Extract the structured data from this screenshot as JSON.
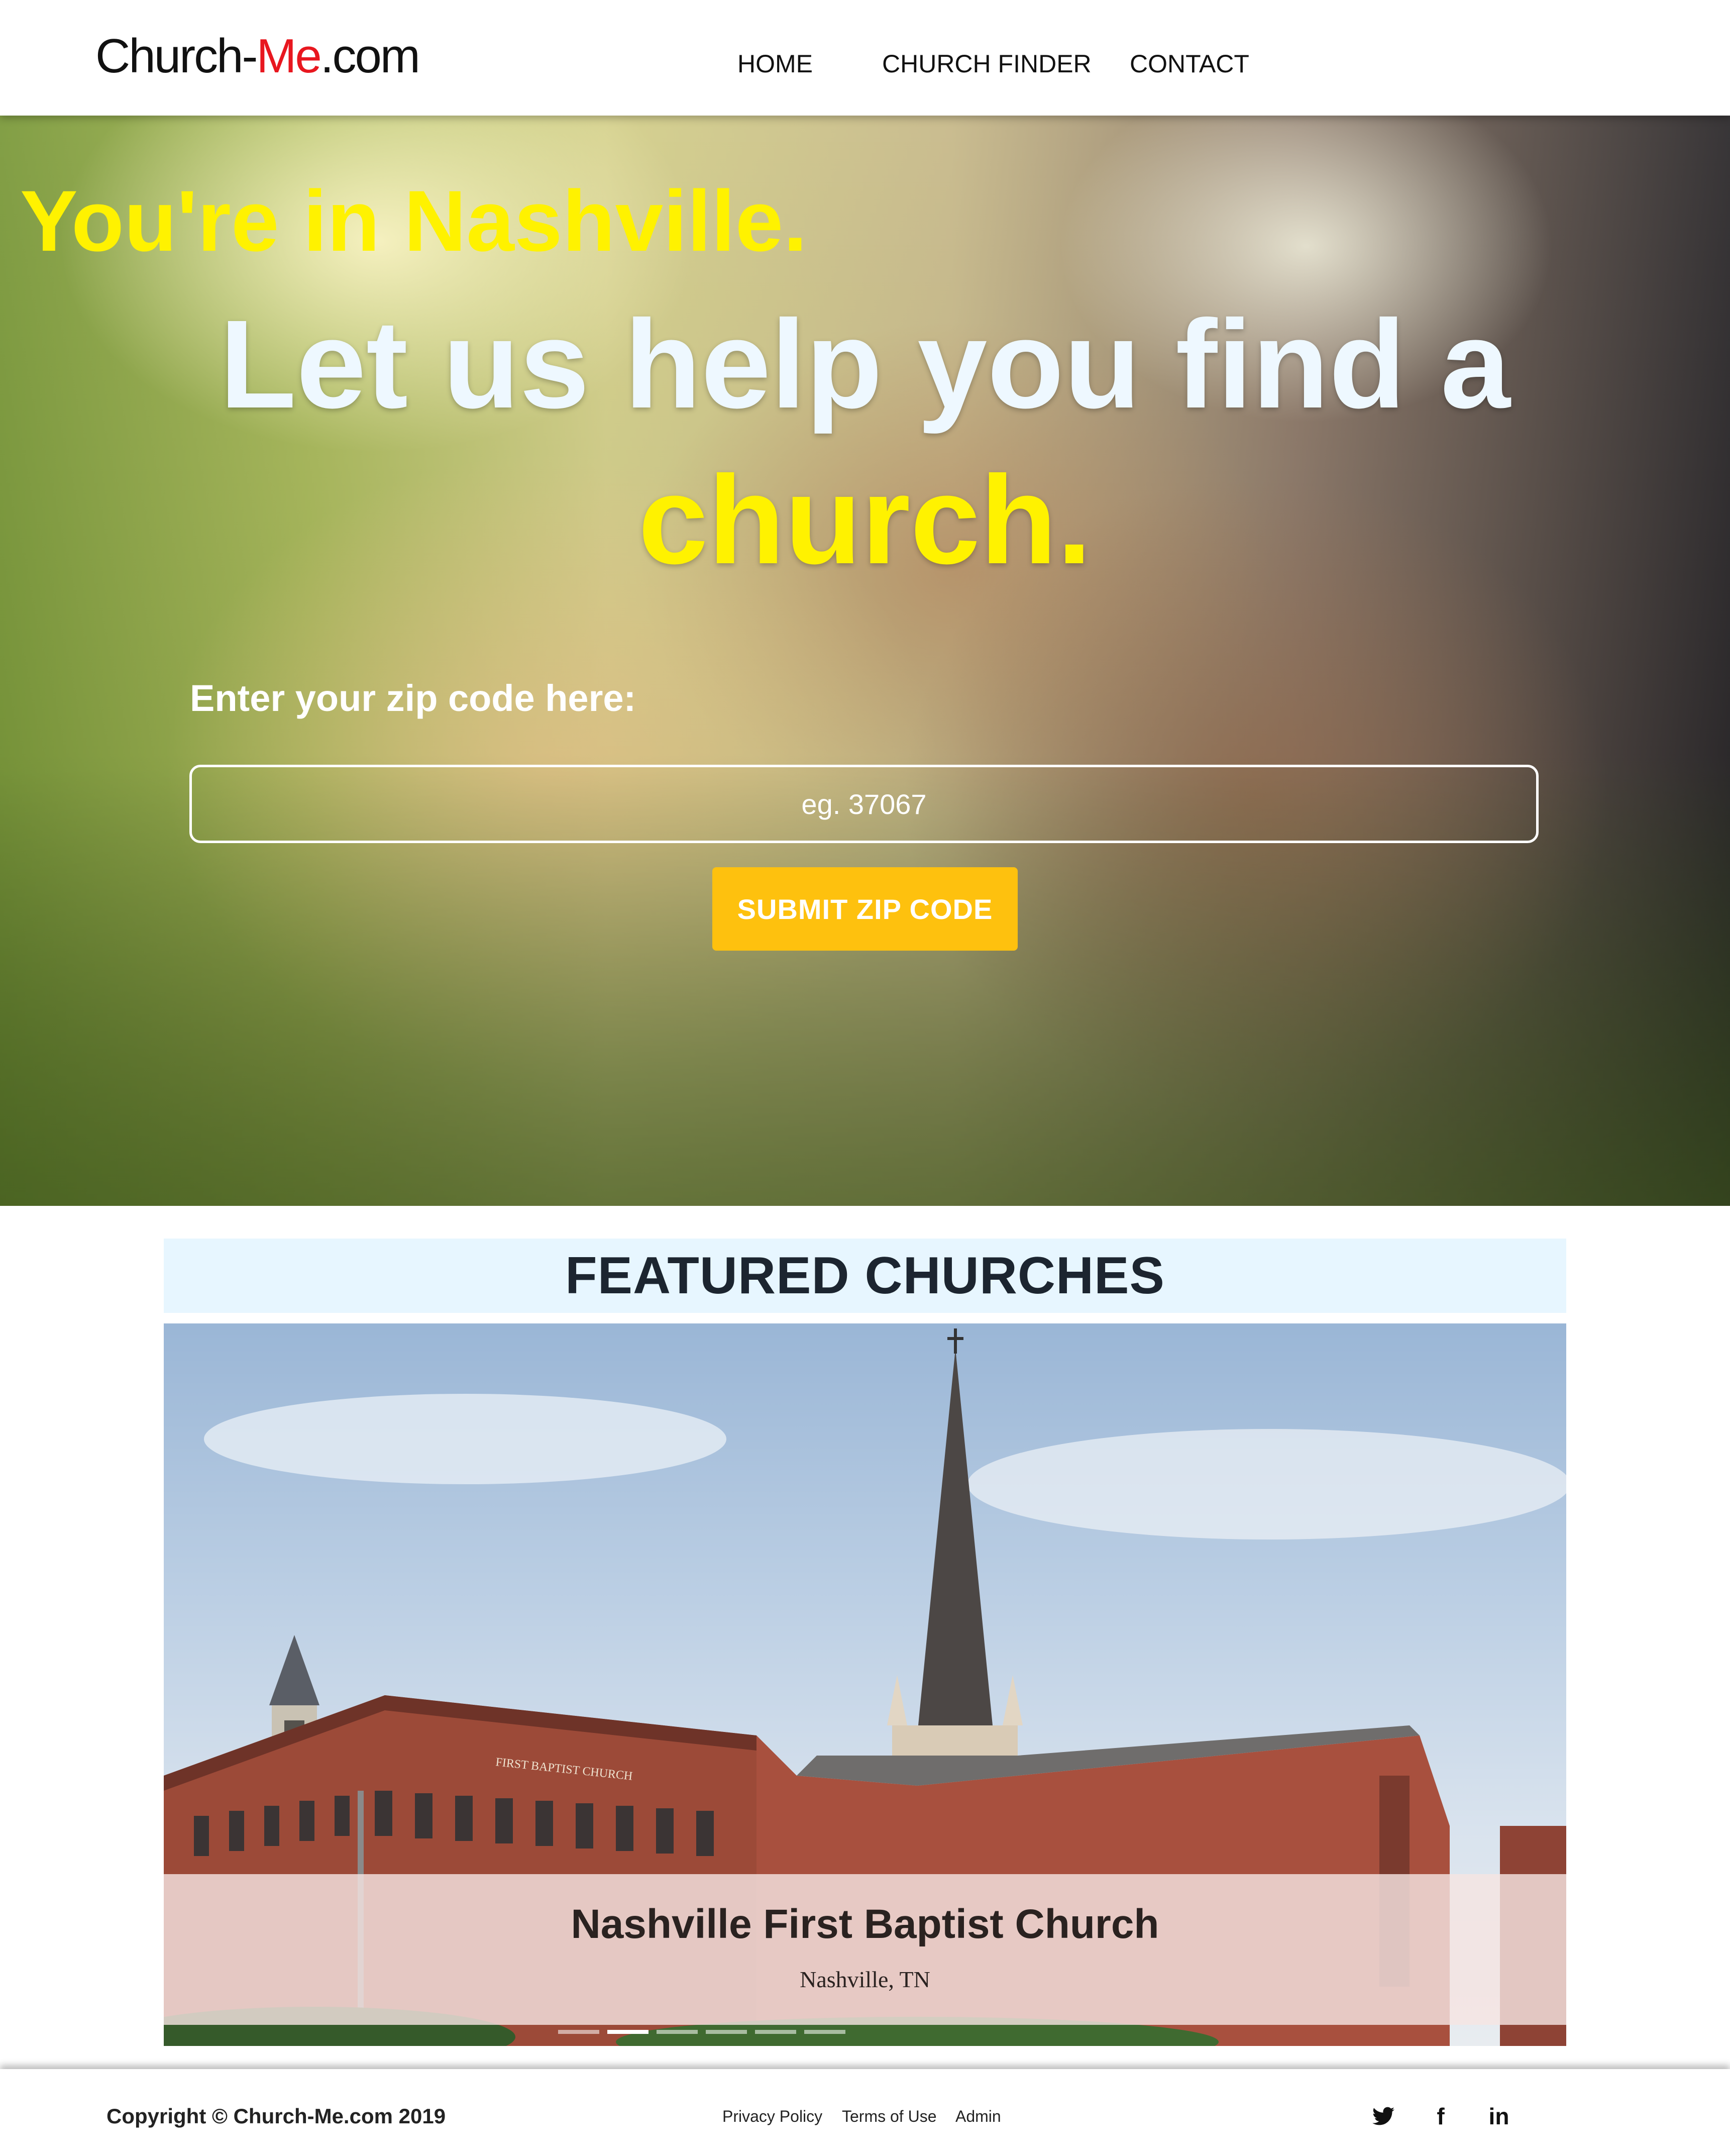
{
  "header": {
    "logo": {
      "part1": "Church-",
      "part2": "Me",
      "part3": ".com"
    },
    "nav": [
      {
        "label": "HOME"
      },
      {
        "label": "CHURCH FINDER"
      },
      {
        "label": "CONTACT"
      }
    ]
  },
  "hero": {
    "subtitle": "You're in Nashville.",
    "title_line": "Let us help you find a",
    "title_highlight": "church.",
    "zip_label": "Enter your zip code here:",
    "zip_placeholder": "eg. 37067",
    "zip_value": "",
    "submit_label": "SUBMIT ZIP CODE"
  },
  "featured": {
    "heading": "FEATURED CHURCHES",
    "slides": [
      {
        "title": "Nashville First Baptist Church",
        "location": "Nashville, TN",
        "sign_text": "FIRST BAPTIST CHURCH"
      }
    ],
    "indicator_count": 6,
    "active_indicator": 2
  },
  "footer": {
    "copyright": "Copyright © Church-Me.com 2019",
    "links": [
      {
        "label": "Privacy Policy"
      },
      {
        "label": "Terms of Use"
      },
      {
        "label": "Admin"
      }
    ],
    "social": [
      {
        "icon": "twitter-icon",
        "glyph": "🐦"
      },
      {
        "icon": "facebook-icon",
        "glyph": "f"
      },
      {
        "icon": "linkedin-icon",
        "glyph": "in"
      }
    ]
  },
  "colors": {
    "accent_yellow": "#fff200",
    "button_yellow": "#fec10e",
    "logo_red": "#e8171f",
    "featured_bg": "#e7f6ff"
  }
}
